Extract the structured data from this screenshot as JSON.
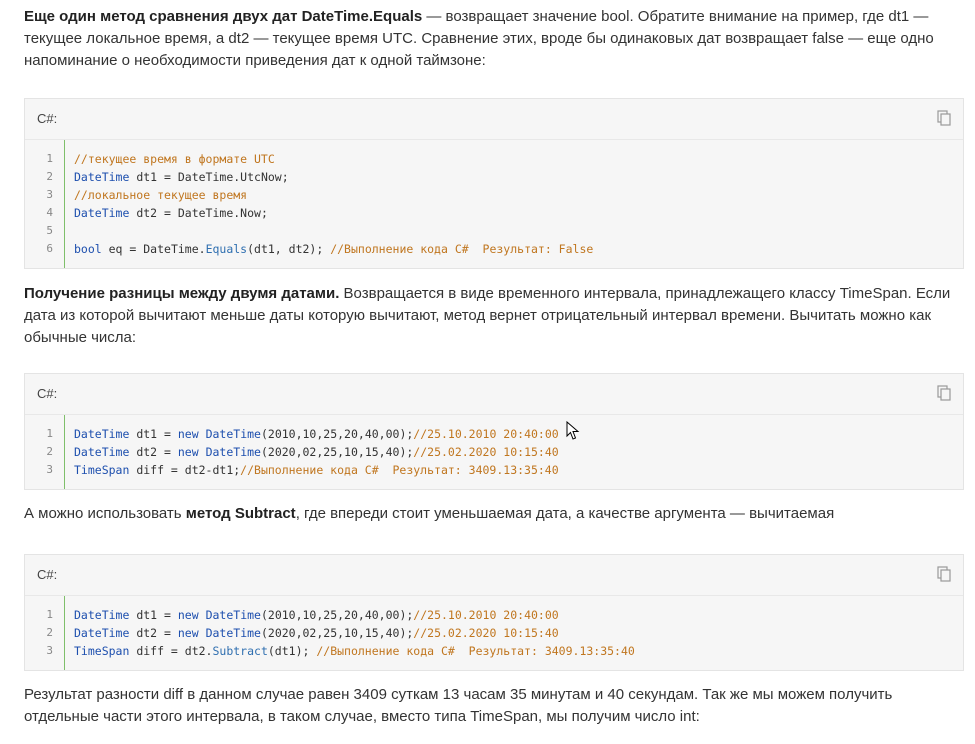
{
  "paragraphs": {
    "p1_bold": "Еще один метод сравнения двух дат DateTime.Equals",
    "p1_rest": " — возвращает значение bool. Обратите внимание на пример, где dt1 — текущее локальное время, а dt2 — текущее время UTC. Сравнение этих, вроде бы одинаковых дат возвращает false — еще одно напоминание о необходимости приведения дат к одной таймзоне:",
    "p2_bold": "Получение разницы между двумя датами.",
    "p2_rest": " Возвращается в виде временного интервала, принадлежащего классу TimeSpan. Если дата из которой вычитают меньше даты которую вычитают, метод вернет отрицательный интервал времени. Вычитать можно как обычные числа:",
    "p3_pre": "А можно использовать ",
    "p3_bold": "метод Subtract",
    "p3_post": ", где впереди стоит уменьшаемая дата, а качестве аргумента — вычитаемая",
    "p4": "Результат разности diff в данном случае равен 3409 суткам 13 часам 35 минутам и 40 секундам. Так же мы можем получить отдельные части этого интервала, в таком случае, вместо типа TimeSpan, мы получим число int:"
  },
  "code_blocks": [
    {
      "lang": "C#:",
      "lines": [
        {
          "n": "1",
          "tokens": [
            {
              "t": "//текущее время в формате UTC",
              "c": "cm"
            }
          ]
        },
        {
          "n": "2",
          "tokens": [
            {
              "t": "DateTime",
              "c": "kw"
            },
            {
              "t": " dt1 = DateTime.UtcNow;",
              "c": ""
            }
          ]
        },
        {
          "n": "3",
          "tokens": [
            {
              "t": "//локальное текущее время",
              "c": "cm"
            }
          ]
        },
        {
          "n": "4",
          "tokens": [
            {
              "t": "DateTime",
              "c": "kw"
            },
            {
              "t": " dt2 = DateTime.Now;",
              "c": ""
            }
          ]
        },
        {
          "n": "5",
          "tokens": []
        },
        {
          "n": "6",
          "tokens": [
            {
              "t": "bool",
              "c": "kw"
            },
            {
              "t": " eq = DateTime.",
              "c": ""
            },
            {
              "t": "Equals",
              "c": "fn"
            },
            {
              "t": "(dt1, dt2); ",
              "c": ""
            },
            {
              "t": "//Выполнение кода C#  Результат: False",
              "c": "cm"
            }
          ]
        }
      ]
    },
    {
      "lang": "C#:",
      "lines": [
        {
          "n": "1",
          "tokens": [
            {
              "t": "DateTime",
              "c": "kw"
            },
            {
              "t": " dt1 = ",
              "c": ""
            },
            {
              "t": "new",
              "c": "kw"
            },
            {
              "t": " ",
              "c": ""
            },
            {
              "t": "DateTime",
              "c": "kw"
            },
            {
              "t": "(2010,10,25,20,40,00);",
              "c": ""
            },
            {
              "t": "//25.10.2010 20:40:00",
              "c": "cm"
            }
          ]
        },
        {
          "n": "2",
          "tokens": [
            {
              "t": "DateTime",
              "c": "kw"
            },
            {
              "t": " dt2 = ",
              "c": ""
            },
            {
              "t": "new",
              "c": "kw"
            },
            {
              "t": " ",
              "c": ""
            },
            {
              "t": "DateTime",
              "c": "kw"
            },
            {
              "t": "(2020,02,25,10,15,40);",
              "c": ""
            },
            {
              "t": "//25.02.2020 10:15:40",
              "c": "cm"
            }
          ]
        },
        {
          "n": "3",
          "tokens": [
            {
              "t": "TimeSpan",
              "c": "kw"
            },
            {
              "t": " diff = dt2-dt1;",
              "c": ""
            },
            {
              "t": "//Выполнение кода C#  Результат: 3409.13:35:40",
              "c": "cm"
            }
          ]
        }
      ]
    },
    {
      "lang": "C#:",
      "lines": [
        {
          "n": "1",
          "tokens": [
            {
              "t": "DateTime",
              "c": "kw"
            },
            {
              "t": " dt1 = ",
              "c": ""
            },
            {
              "t": "new",
              "c": "kw"
            },
            {
              "t": " ",
              "c": ""
            },
            {
              "t": "DateTime",
              "c": "kw"
            },
            {
              "t": "(2010,10,25,20,40,00);",
              "c": ""
            },
            {
              "t": "//25.10.2010 20:40:00",
              "c": "cm"
            }
          ]
        },
        {
          "n": "2",
          "tokens": [
            {
              "t": "DateTime",
              "c": "kw"
            },
            {
              "t": " dt2 = ",
              "c": ""
            },
            {
              "t": "new",
              "c": "kw"
            },
            {
              "t": " ",
              "c": ""
            },
            {
              "t": "DateTime",
              "c": "kw"
            },
            {
              "t": "(2020,02,25,10,15,40);",
              "c": ""
            },
            {
              "t": "//25.02.2020 10:15:40",
              "c": "cm"
            }
          ]
        },
        {
          "n": "3",
          "tokens": [
            {
              "t": "TimeSpan",
              "c": "kw"
            },
            {
              "t": " diff = dt2.",
              "c": ""
            },
            {
              "t": "Subtract",
              "c": "fn"
            },
            {
              "t": "(dt1); ",
              "c": ""
            },
            {
              "t": "//Выполнение кода C#  Результат: 3409.13:35:40",
              "c": "cm"
            }
          ]
        }
      ]
    }
  ],
  "icons": {
    "copy": "copy-icon",
    "cursor": "mouse-cursor-icon"
  },
  "colors": {
    "keyword": "#1d4fae",
    "comment": "#c0761f",
    "method": "#2f6fb0",
    "gutter": "#7fbf6a",
    "code_bg": "#f6f6f6"
  }
}
